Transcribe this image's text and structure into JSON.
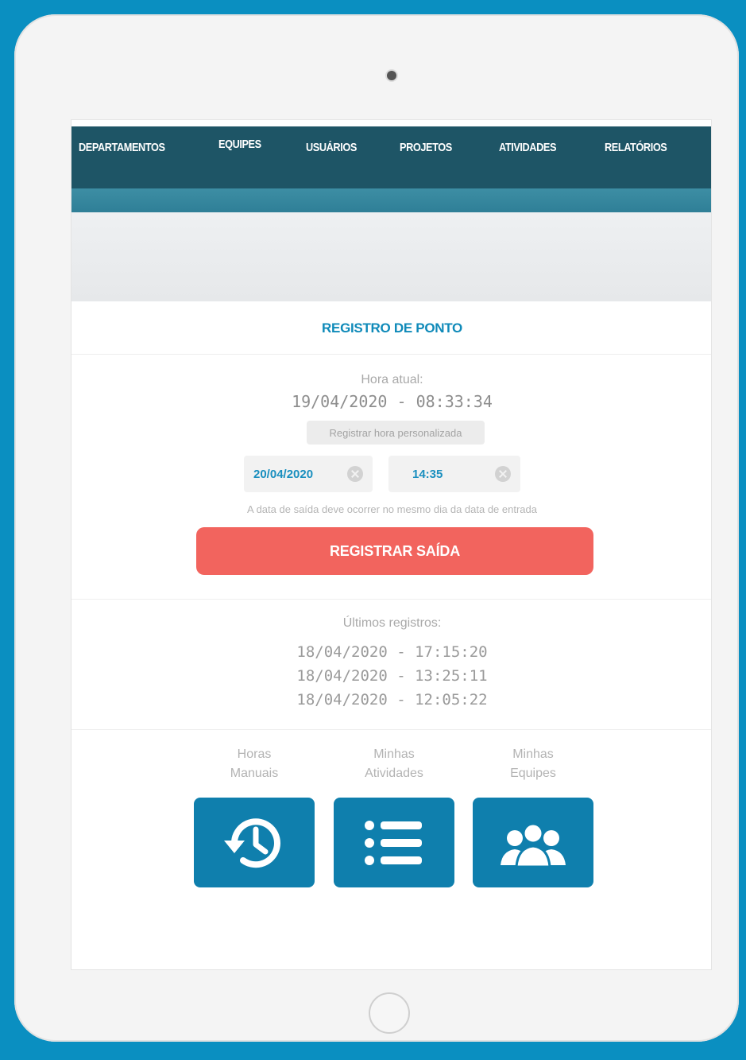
{
  "nav": {
    "items": [
      "DEPARTAMENTOS",
      "EQUIPES",
      "USUÁRIOS",
      "PROJETOS",
      "ATIVIDADES",
      "RELATÓRIOS"
    ]
  },
  "ponto": {
    "title": "REGISTRO DE PONTO",
    "current_label": "Hora atual:",
    "current_time": "19/04/2020 - 08:33:34",
    "custom_hour_button": "Registrar hora personalizada",
    "date_value": "20/04/2020",
    "time_value": "14:35",
    "hint": "A data de saída deve ocorrer no mesmo dia da data de entrada",
    "register_button": "REGISTRAR SAÍDA"
  },
  "recent": {
    "label": "Últimos registros:",
    "entries": [
      "18/04/2020 - 17:15:20",
      "18/04/2020 - 13:25:11",
      "18/04/2020 - 12:05:22"
    ]
  },
  "shortcuts": [
    {
      "line1": "Horas",
      "line2": "Manuais",
      "icon": "history-icon"
    },
    {
      "line1": "Minhas",
      "line2": "Atividades",
      "icon": "list-icon"
    },
    {
      "line1": "Minhas",
      "line2": "Equipes",
      "icon": "team-icon"
    }
  ],
  "colors": {
    "background": "#0a8fc1",
    "nav": "#1e5566",
    "accent": "#0f8ab9",
    "danger_button": "#f2645e",
    "tile": "#0f7fad"
  }
}
